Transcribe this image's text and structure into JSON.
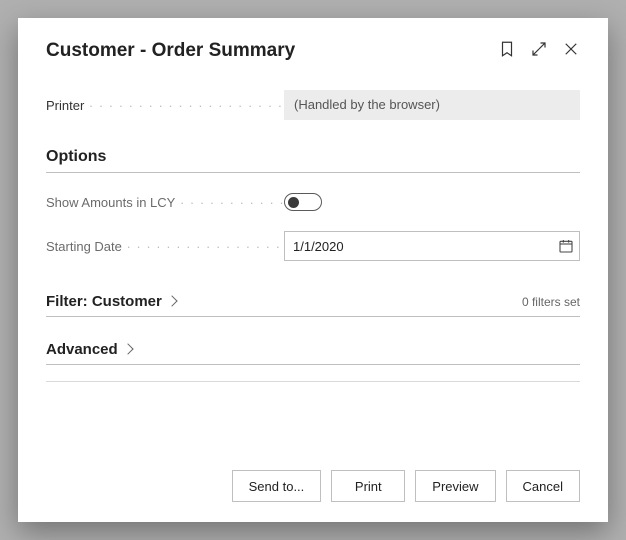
{
  "header": {
    "title": "Customer - Order Summary"
  },
  "printer": {
    "label": "Printer",
    "value": "(Handled by the browser)"
  },
  "sections": {
    "options_heading": "Options",
    "show_lcy_label": "Show Amounts in LCY",
    "show_lcy_on": false,
    "starting_date_label": "Starting Date",
    "starting_date_value": "1/1/2020",
    "filter_heading": "Filter: Customer",
    "filter_count_text": "0 filters set",
    "advanced_heading": "Advanced"
  },
  "buttons": {
    "send_to": "Send to...",
    "print": "Print",
    "preview": "Preview",
    "cancel": "Cancel"
  }
}
